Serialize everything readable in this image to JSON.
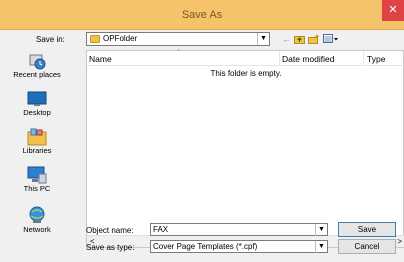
{
  "window": {
    "title": "Save As",
    "close_glyph": "✕"
  },
  "toolbar": {
    "save_in_label": "Save in:",
    "folder_name": "OPFolder",
    "dropdown_glyph": "▼",
    "back_glyph": "←",
    "icons": [
      "back-icon",
      "up-folder-icon",
      "new-folder-icon",
      "view-menu-icon"
    ]
  },
  "places": [
    {
      "label": "Recent places",
      "icon": "recent-places-icon"
    },
    {
      "label": "Desktop",
      "icon": "desktop-icon"
    },
    {
      "label": "Libraries",
      "icon": "libraries-icon"
    },
    {
      "label": "This PC",
      "icon": "this-pc-icon"
    },
    {
      "label": "Network",
      "icon": "network-icon"
    }
  ],
  "file_list": {
    "columns": [
      "Name",
      "Date modified",
      "Type"
    ],
    "empty_message": "This folder is empty.",
    "scroll_left": "<",
    "scroll_right": ">"
  },
  "form": {
    "object_name_label": "Object name:",
    "object_name_value": "FAX",
    "save_as_type_label": "Save as type:",
    "save_as_type_value": "Cover Page Templates (*.cpf)",
    "dropdown_glyph": "▼"
  },
  "buttons": {
    "save": "Save",
    "cancel": "Cancel"
  },
  "colors": {
    "titlebar": "#f5c36a",
    "close": "#e04343",
    "accent": "#3c7fb1"
  }
}
